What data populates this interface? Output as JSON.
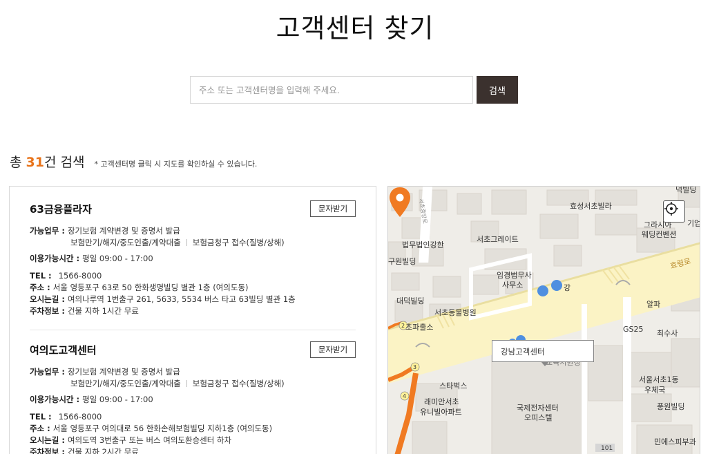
{
  "header": {
    "title": "고객센터 찾기"
  },
  "search": {
    "placeholder": "주소 또는 고객센터명을 입력해 주세요.",
    "button_label": "검색"
  },
  "result": {
    "prefix": "총 ",
    "count": "31",
    "suffix": "건 검색",
    "note": "* 고객센터명 클릭 시 지도를 확인하실 수 있습니다."
  },
  "centers": [
    {
      "name": "63금융플라자",
      "sms_label": "문자받기",
      "biz_label": "가능업무 :",
      "biz_line1": "장기보험 계약변경 및 증명서 발급",
      "biz_line2a": "보험만기/해지/중도인출/계약대출",
      "biz_line2b": "보험금청구 접수(질병/상해)",
      "hours_label": "이용가능시간 :",
      "hours": "평일 09:00 - 17:00",
      "tel_label": "TEL :",
      "tel": "1566-8000",
      "addr_label": "주소 :",
      "addr": "서울 영등포구 63로 50 한화생명빌딩 별관 1층 (여의도동)",
      "route_label": "오시는길 :",
      "route": "여의나루역 1번출구 261, 5633, 5534 버스 타고 63빌딩 별관 1층",
      "parking_label": "주차정보 :",
      "parking": "건물 지하 1시간 무료"
    },
    {
      "name": "여의도고객센터",
      "sms_label": "문자받기",
      "biz_label": "가능업무 :",
      "biz_line1": "장기보험 계약변경 및 증명서 발급",
      "biz_line2a": "보험만기/해지/중도인출/계약대출",
      "biz_line2b": "보험금청구 접수(질병/상해)",
      "hours_label": "이용가능시간 :",
      "hours": "평일 09:00 - 17:00",
      "tel_label": "TEL :",
      "tel": "1566-8000",
      "addr_label": "주소 :",
      "addr": "서울 영등포구 여의대로 56 한화손해보험빌딩 지하1층 (여의도동)",
      "route_label": "오시는길 :",
      "route": "여의도역 3번출구 또는 버스 여의도환승센터 하차",
      "parking_label": "주차정보 :",
      "parking": "건물 지하 2시간 무료"
    }
  ],
  "map": {
    "tooltip": "강남고객센터",
    "labels": {
      "hyosung": "효성서초빌라",
      "seocho_gate": "서초그레이트",
      "beobmu": "법무법인강한",
      "gu_bldg": "구원빌딩",
      "ipgyeong": "임경법무사",
      "samuso": "사무소",
      "gang": "강",
      "daedeok": "대덕빌딩",
      "hospital": "서초동물병원",
      "police": "초파출소",
      "starbucks": "스타벅스",
      "ramian1": "래미안서초",
      "ramian2": "유니빌아파트",
      "intl1": "국제전자센터",
      "intl2": "오피스텔",
      "alpa": "알파",
      "gs25": "GS25",
      "choesu": "최수사",
      "post1": "서울서초1동",
      "post2": "우체국",
      "pungwon": "풍원빌딩",
      "skin": "민에스피부과",
      "wedding1": "그라시아",
      "wedding2": "웨딩컨벤션",
      "hyoryeong": "효령로",
      "gi": "기업",
      "top_right": "덕빌딩",
      "road_vertical": "서초중앙로",
      "gyoyuk": "교육지원청",
      "n101": "101"
    }
  }
}
